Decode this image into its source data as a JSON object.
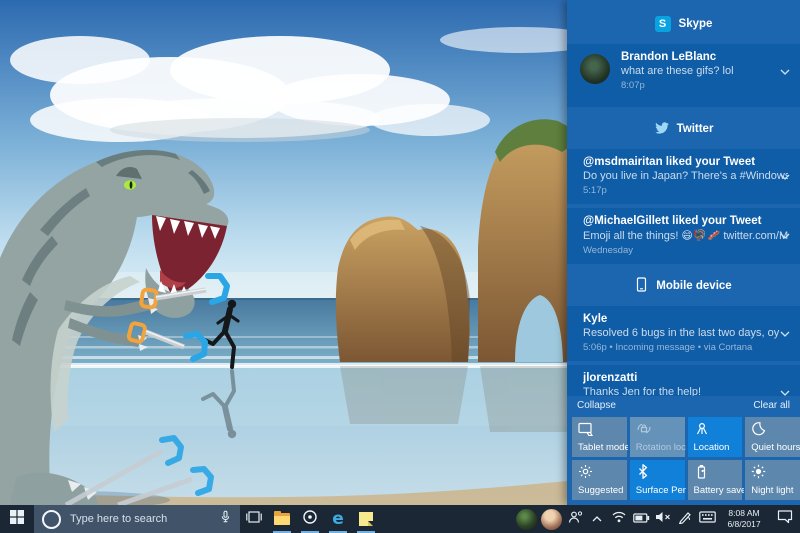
{
  "action_center": {
    "skype": {
      "title": "Skype",
      "badge_glyph": "S",
      "n1": {
        "title": "Brandon LeBlanc",
        "body": "what are these gifs? lol",
        "time": "8:07p"
      }
    },
    "twitter": {
      "title": "Twitter",
      "n1": {
        "title": "@msdmairitan liked your Tweet",
        "body": "Do you live in Japan? There's a #WindowsInside",
        "time": "5:17p"
      },
      "n2": {
        "title": "@MichaelGillett liked your Tweet",
        "body": "Emoji all the things! 😄🦃🥓 twitter.com/Mich",
        "time": "Wednesday"
      }
    },
    "mobile": {
      "title": "Mobile device",
      "n1": {
        "title": "Kyle",
        "body": "Resolved 6 bugs in the last two days, oy",
        "time": "5:06p • Incoming message • via Cortana"
      },
      "n2": {
        "title": "jlorenzatti",
        "body": "Thanks Jen for the help!"
      }
    },
    "collapse_label": "Collapse",
    "clear_all_label": "Clear all",
    "quick_actions": [
      {
        "label": "Tablet mode",
        "state": "off",
        "icon": "tablet-mode-icon"
      },
      {
        "label": "Rotation lock",
        "state": "disabled",
        "icon": "rotation-lock-icon"
      },
      {
        "label": "Location",
        "state": "on",
        "icon": "location-pin-icon"
      },
      {
        "label": "Quiet hours",
        "state": "off",
        "icon": "moon-icon"
      },
      {
        "label": "Suggested",
        "state": "off",
        "icon": "sun-outline-icon"
      },
      {
        "label": "Surface Pen",
        "state": "on",
        "icon": "bluetooth-icon"
      },
      {
        "label": "Battery saver",
        "state": "off",
        "icon": "battery-vertical-icon"
      },
      {
        "label": "Night light",
        "state": "off",
        "icon": "sun-filled-icon"
      }
    ],
    "colors": {
      "panel": "#1b66af",
      "card": "#0f5ca7",
      "active_tile": "#1080d8",
      "skype_brand": "#09a3e2"
    }
  },
  "taskbar": {
    "search": {
      "placeholder": "Type here to search"
    },
    "clock": {
      "time": "8:08 AM",
      "date": "6/8/2017"
    },
    "glyphs": {
      "edge": "e"
    }
  }
}
